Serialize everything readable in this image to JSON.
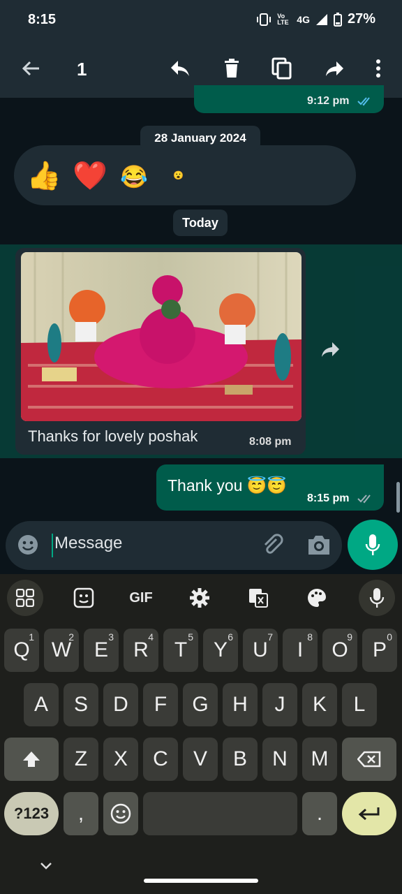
{
  "status_bar": {
    "time": "8:15",
    "network": "4G",
    "volte": "Vo LTE",
    "battery": "27%"
  },
  "action_bar": {
    "selected_count": "1"
  },
  "chat": {
    "top_message_time": "9:12 pm",
    "date_chip": "28 January 2024",
    "reactions": [
      "👍",
      "❤️",
      "😂",
      "😮"
    ],
    "today_chip": "Today",
    "image_message": {
      "caption": "Thanks for lovely poshak",
      "time": "8:08 pm"
    },
    "outgoing_message": {
      "text": "Thank you 😇😇",
      "time": "8:15 pm"
    }
  },
  "composer": {
    "placeholder": "Message"
  },
  "keyboard": {
    "toolbar": [
      "apps-icon",
      "sticker-icon",
      "GIF",
      "settings-icon",
      "translate-icon",
      "palette-icon",
      "mic-icon"
    ],
    "gif_label": "GIF",
    "row1": [
      [
        "Q",
        "1"
      ],
      [
        "W",
        "2"
      ],
      [
        "E",
        "3"
      ],
      [
        "R",
        "4"
      ],
      [
        "T",
        "5"
      ],
      [
        "Y",
        "6"
      ],
      [
        "U",
        "7"
      ],
      [
        "I",
        "8"
      ],
      [
        "O",
        "9"
      ],
      [
        "P",
        "0"
      ]
    ],
    "row2": [
      "A",
      "S",
      "D",
      "F",
      "G",
      "H",
      "J",
      "K",
      "L"
    ],
    "row3": [
      "Z",
      "X",
      "C",
      "V",
      "B",
      "N",
      "M"
    ],
    "sym_label": "?123",
    "comma": ",",
    "period": "."
  },
  "colors": {
    "accent": "#00a884",
    "bubble_out": "#005c4b",
    "bubble_in": "#1f2c34",
    "bg": "#0b141a"
  }
}
